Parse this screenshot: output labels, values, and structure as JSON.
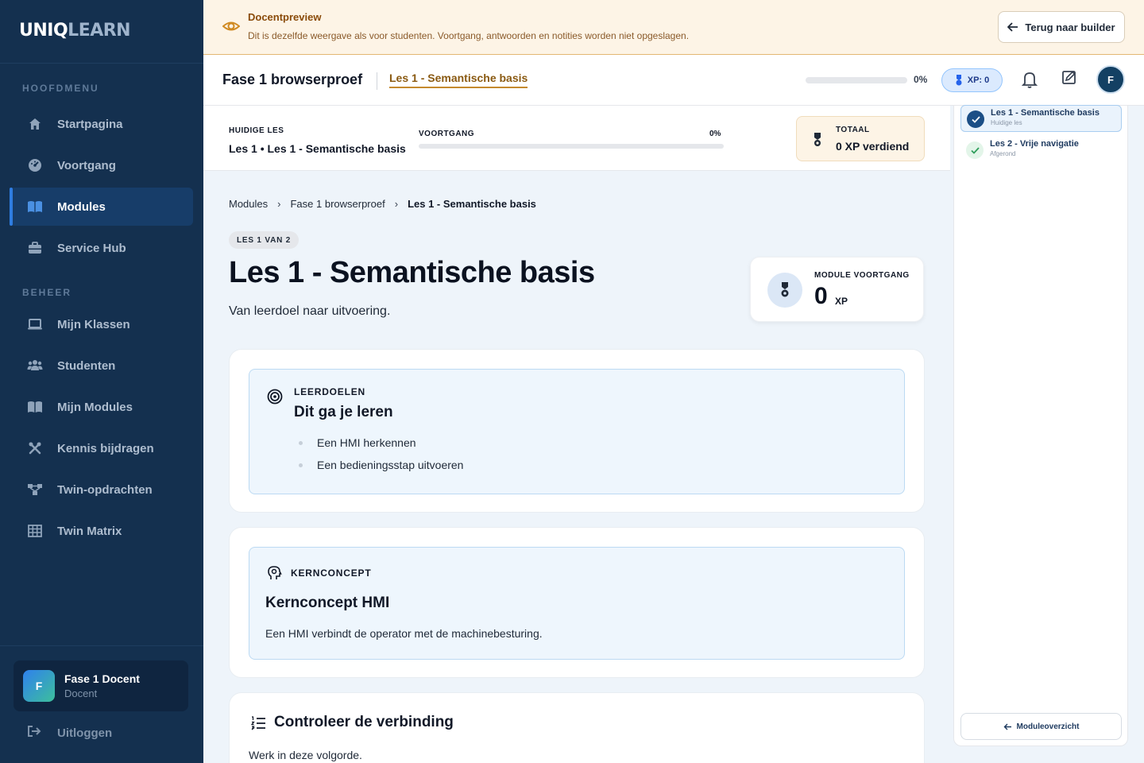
{
  "brand": {
    "part1": "UNIQ",
    "part2": "LEARN"
  },
  "sidebar": {
    "section_main": "HOOFDMENU",
    "section_admin": "BEHEER",
    "items": [
      {
        "label": "Startpagina",
        "icon": "home-icon"
      },
      {
        "label": "Voortgang",
        "icon": "gauge-icon"
      },
      {
        "label": "Modules",
        "icon": "book-icon",
        "active": true
      },
      {
        "label": "Service Hub",
        "icon": "toolbox-icon"
      },
      {
        "label": "Mijn Klassen",
        "icon": "laptop-icon"
      },
      {
        "label": "Studenten",
        "icon": "users-icon"
      },
      {
        "label": "Mijn Modules",
        "icon": "book-icon"
      },
      {
        "label": "Kennis bijdragen",
        "icon": "tools-icon"
      },
      {
        "label": "Twin-opdrachten",
        "icon": "diagram-icon"
      },
      {
        "label": "Twin Matrix",
        "icon": "grid-icon"
      }
    ],
    "user": {
      "initial": "F",
      "name": "Fase 1 Docent",
      "role": "Docent"
    },
    "logout": "Uitloggen"
  },
  "banner": {
    "title": "Docentpreview",
    "text": "Dit is dezelfde weergave als voor studenten. Voortgang, antwoorden en notities worden niet opgeslagen.",
    "back_button": "Terug naar builder"
  },
  "topbar": {
    "course_title": "Fase 1 browserproef",
    "lesson_tab": "Les 1 - Semantische basis",
    "progress_pct": "0%",
    "progress_value": 0,
    "xp_label": "XP: 0",
    "avatar_initial": "F"
  },
  "strip": {
    "current_label": "HUIDIGE LES",
    "current_value": "Les 1 • Les 1 - Semantische basis",
    "progress_label": "VOORTGANG",
    "progress_pct": "0%",
    "total_label": "TOTAAL",
    "total_value": "0 XP verdiend"
  },
  "breadcrumb": {
    "items": [
      "Modules",
      "Fase 1 browserproef",
      "Les 1 - Semantische basis"
    ],
    "separator": "›"
  },
  "lesson": {
    "badge": "LES 1 VAN 2",
    "title": "Les 1 - Semantische basis",
    "subtitle": "Van leerdoel naar uitvoering.",
    "module_progress_label": "MODULE VOORTGANG",
    "module_progress_value": "0",
    "module_progress_unit": "XP"
  },
  "goals": {
    "label": "LEERDOELEN",
    "title": "Dit ga je leren",
    "items": [
      "Een HMI herkennen",
      "Een bedieningsstap uitvoeren"
    ]
  },
  "concept": {
    "label": "KERNCONCEPT",
    "title": "Kernconcept HMI",
    "text": "Een HMI verbindt de operator met de machinebesturing."
  },
  "steps": {
    "title": "Controleer de verbinding",
    "text": "Werk in deze volgorde."
  },
  "right_panel": {
    "items": [
      {
        "title": "Les 1 - Semantische basis",
        "sub": "Huidige les",
        "state": "current"
      },
      {
        "title": "Les 2 - Vrije navigatie",
        "sub": "Afgerond",
        "state": "done"
      }
    ],
    "overview_button": "Moduleoverzicht"
  },
  "colors": {
    "sidebar_bg": "#14304f",
    "accent_blue": "#2f7de1",
    "banner_bg": "#fdf4e6",
    "lesson_tab": "#8a5a12"
  }
}
